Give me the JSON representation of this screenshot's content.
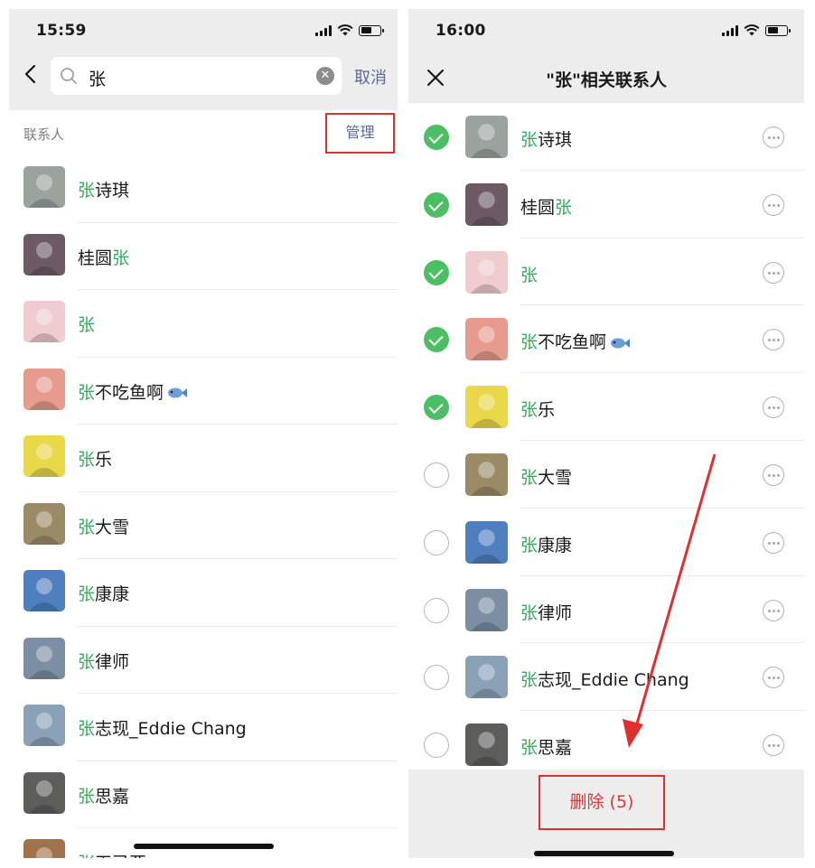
{
  "left": {
    "time": "15:59",
    "search": {
      "value": "张",
      "cancel": "取消"
    },
    "section_title": "联系人",
    "manage": "管理",
    "contacts": [
      {
        "hl_pre": "张",
        "rest": "诗琪",
        "hl_post": "",
        "emoji": false,
        "avatar_color": "#9aa39e"
      },
      {
        "hl_pre": "",
        "rest": "桂圆",
        "hl_post": "张",
        "emoji": false,
        "avatar_color": "#6e5a65"
      },
      {
        "hl_pre": "",
        "rest": "",
        "hl_post": "张",
        "emoji": false,
        "avatar_color": "#f0ccd0"
      },
      {
        "hl_pre": "张",
        "rest": "不吃鱼啊",
        "hl_post": "",
        "emoji": true,
        "avatar_color": "#e79a8e"
      },
      {
        "hl_pre": "张",
        "rest": "乐",
        "hl_post": "",
        "emoji": false,
        "avatar_color": "#e8d84a"
      },
      {
        "hl_pre": "张",
        "rest": "大雪",
        "hl_post": "",
        "emoji": false,
        "avatar_color": "#9b8a66"
      },
      {
        "hl_pre": "张",
        "rest": "康康",
        "hl_post": "",
        "emoji": false,
        "avatar_color": "#4f7fbf"
      },
      {
        "hl_pre": "张",
        "rest": "律师",
        "hl_post": "",
        "emoji": false,
        "avatar_color": "#7c8ea3"
      },
      {
        "hl_pre": "张",
        "rest": "志现_Eddie Chang",
        "hl_post": "",
        "emoji": false,
        "avatar_color": "#8aa1b8"
      },
      {
        "hl_pre": "张",
        "rest": "思嘉",
        "hl_post": "",
        "emoji": false,
        "avatar_color": "#5d5e5c"
      },
      {
        "hl_pre": "张",
        "rest": "天已亚",
        "hl_post": "",
        "emoji": false,
        "avatar_color": "#a0734a"
      }
    ]
  },
  "right": {
    "time": "16:00",
    "title": "\"张\"相关联系人",
    "contacts": [
      {
        "hl_pre": "张",
        "rest": "诗琪",
        "hl_post": "",
        "emoji": false,
        "checked": true,
        "avatar_color": "#9aa39e"
      },
      {
        "hl_pre": "",
        "rest": "桂圆",
        "hl_post": "张",
        "emoji": false,
        "checked": true,
        "avatar_color": "#6e5a65"
      },
      {
        "hl_pre": "",
        "rest": "",
        "hl_post": "张",
        "emoji": false,
        "checked": true,
        "avatar_color": "#f0ccd0"
      },
      {
        "hl_pre": "张",
        "rest": "不吃鱼啊",
        "hl_post": "",
        "emoji": true,
        "checked": true,
        "avatar_color": "#e79a8e"
      },
      {
        "hl_pre": "张",
        "rest": "乐",
        "hl_post": "",
        "emoji": false,
        "checked": true,
        "avatar_color": "#e8d84a"
      },
      {
        "hl_pre": "张",
        "rest": "大雪",
        "hl_post": "",
        "emoji": false,
        "checked": false,
        "avatar_color": "#9b8a66"
      },
      {
        "hl_pre": "张",
        "rest": "康康",
        "hl_post": "",
        "emoji": false,
        "checked": false,
        "avatar_color": "#4f7fbf"
      },
      {
        "hl_pre": "张",
        "rest": "律师",
        "hl_post": "",
        "emoji": false,
        "checked": false,
        "avatar_color": "#7c8ea3"
      },
      {
        "hl_pre": "张",
        "rest": "志现_Eddie Chang",
        "hl_post": "",
        "emoji": false,
        "checked": false,
        "avatar_color": "#8aa1b8"
      },
      {
        "hl_pre": "张",
        "rest": "思嘉",
        "hl_post": "",
        "emoji": false,
        "checked": false,
        "avatar_color": "#5d5e5c"
      }
    ],
    "delete_label": "删除 (5)"
  },
  "colors": {
    "highlight": "#3aa85c",
    "link": "#576b95",
    "check": "#4cbf64",
    "annotation": "#e02f2f"
  }
}
